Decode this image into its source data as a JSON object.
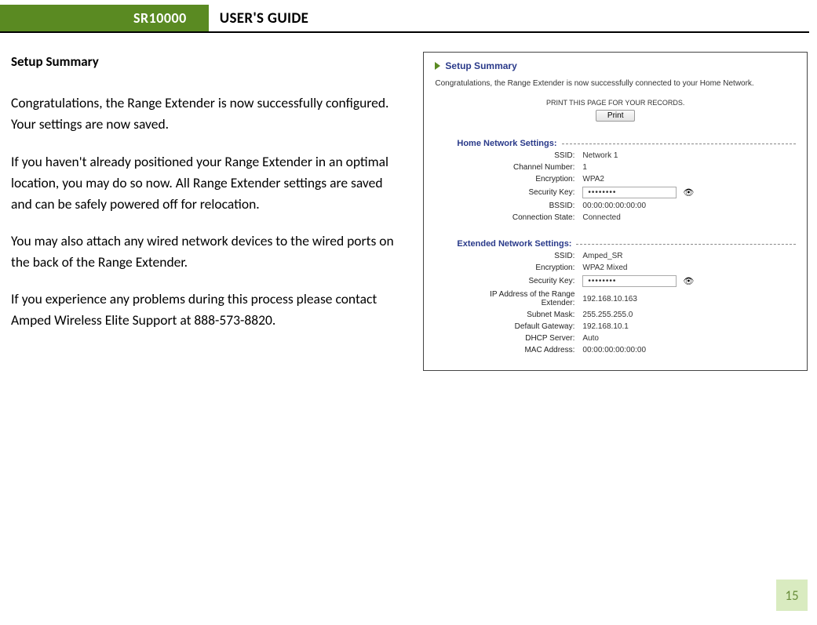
{
  "header": {
    "product": "SR10000",
    "title": "USER'S GUIDE"
  },
  "left": {
    "section_title": "Setup Summary",
    "p1": "Congratulations, the Range Extender is now successfully configured.  Your settings are now saved.",
    "p2": "If you haven't already positioned your Range Extender in an optimal location, you may do so now.  All Range Extender settings are saved and can be safely powered off for relocation.",
    "p3": "You may also attach any wired network devices to the wired ports on the back of the Range Extender.",
    "p4": "If you experience any problems during this process please contact Amped Wireless Elite Support at 888-573-8820."
  },
  "screenshot": {
    "title": "Setup Summary",
    "congrats": "Congratulations, the Range Extender is now successfully connected to your Home Network.",
    "print_caption": "PRINT THIS PAGE FOR YOUR RECORDS.",
    "print_btn": "Print",
    "home_section": "Home Network Settings:",
    "home": {
      "ssid_label": "SSID:",
      "ssid": "Network 1",
      "channel_label": "Channel Number:",
      "channel": "1",
      "encryption_label": "Encryption:",
      "encryption": "WPA2",
      "key_label": "Security Key:",
      "key": "••••••••",
      "bssid_label": "BSSID:",
      "bssid": "00:00:00:00:00:00",
      "state_label": "Connection State:",
      "state": "Connected"
    },
    "ext_section": "Extended Network Settings:",
    "ext": {
      "ssid_label": "SSID:",
      "ssid": "Amped_SR",
      "encryption_label": "Encryption:",
      "encryption": "WPA2 Mixed",
      "key_label": "Security Key:",
      "key": "••••••••",
      "ip_label": "IP Address of the Range Extender:",
      "ip": "192.168.10.163",
      "subnet_label": "Subnet Mask:",
      "subnet": "255.255.255.0",
      "gateway_label": "Default Gateway:",
      "gateway": "192.168.10.1",
      "dhcp_label": "DHCP Server:",
      "dhcp": "Auto",
      "mac_label": "MAC Address:",
      "mac": "00:00:00:00:00:00"
    }
  },
  "page_number": "15"
}
